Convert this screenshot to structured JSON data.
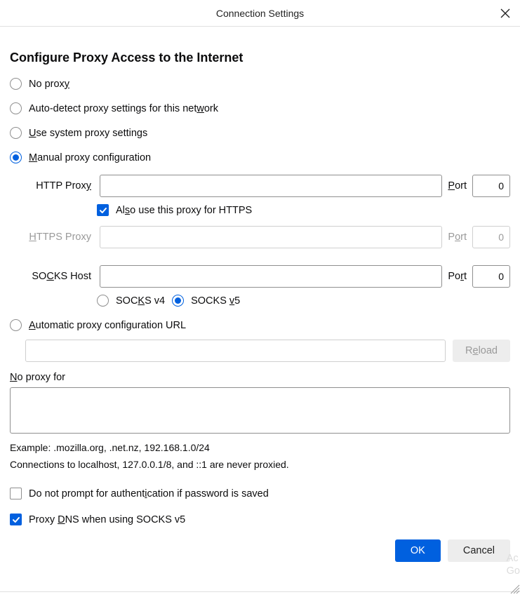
{
  "title": "Connection Settings",
  "heading": "Configure Proxy Access to the Internet",
  "radios": {
    "no_proxy": "No proxy",
    "auto_detect": "Auto-detect proxy settings for this network",
    "system": "Use system proxy settings",
    "manual": "Manual proxy configuration",
    "auto_url": "Automatic proxy configuration URL"
  },
  "manual": {
    "http_label": "HTTP Proxy",
    "http_value": "",
    "http_port_label": "Port",
    "http_port_value": "0",
    "also_https": "Also use this proxy for HTTPS",
    "https_label": "HTTPS Proxy",
    "https_value": "",
    "https_port_label": "Port",
    "https_port_value": "0",
    "socks_label": "SOCKS Host",
    "socks_value": "",
    "socks_port_label": "Port",
    "socks_port_value": "0",
    "socks_v4": "SOCKS v4",
    "socks_v5": "SOCKS v5"
  },
  "pac": {
    "url_value": "",
    "reload_label": "Reload"
  },
  "no_proxy_for": {
    "label": "No proxy for",
    "value": "",
    "example": "Example: .mozilla.org, .net.nz, 192.168.1.0/24",
    "note": "Connections to localhost, 127.0.0.1/8, and ::1 are never proxied."
  },
  "checks": {
    "no_prompt": "Do not prompt for authentication if password is saved",
    "proxy_dns": "Proxy DNS when using SOCKS v5"
  },
  "buttons": {
    "ok": "OK",
    "cancel": "Cancel"
  },
  "watermark": {
    "l1": "Ac",
    "l2": "Go"
  },
  "colors": {
    "accent": "#0060df"
  }
}
